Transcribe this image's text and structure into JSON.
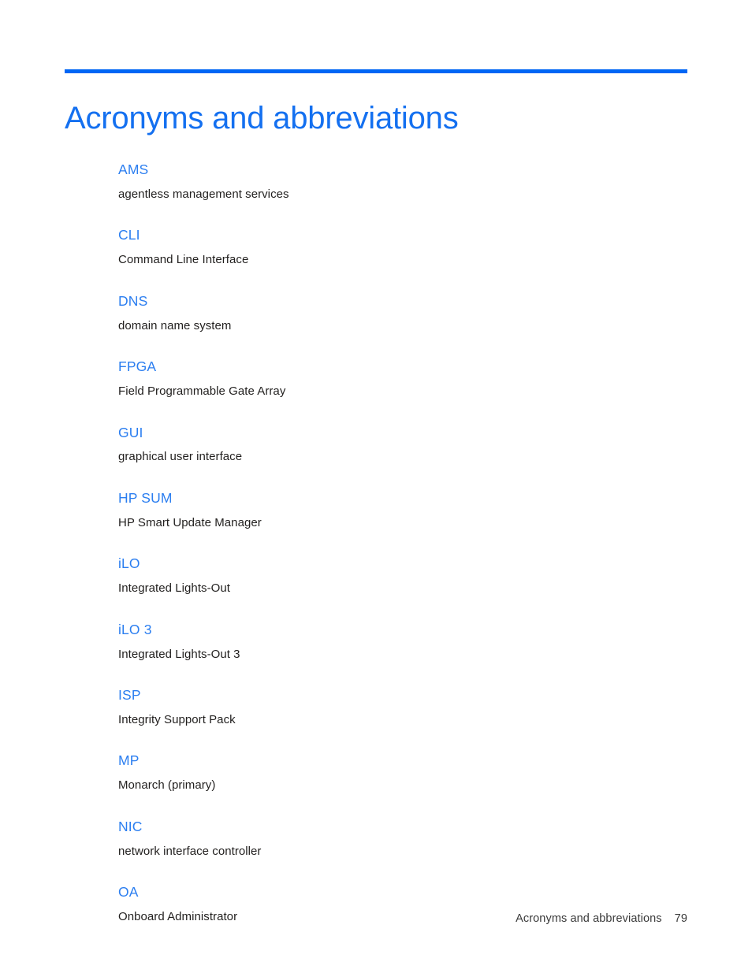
{
  "document": {
    "page_title": "Acronyms and abbreviations",
    "accent_color": "#0066f5",
    "title_color": "#1470f0",
    "term_color": "#2b7ef0",
    "definition_color": "#211f1e"
  },
  "glossary": {
    "entries": [
      {
        "term": "AMS",
        "definition": "agentless management services"
      },
      {
        "term": "CLI",
        "definition": "Command Line Interface"
      },
      {
        "term": "DNS",
        "definition": "domain name system"
      },
      {
        "term": "FPGA",
        "definition": "Field Programmable Gate Array"
      },
      {
        "term": "GUI",
        "definition": "graphical user interface"
      },
      {
        "term": "HP SUM",
        "definition": "HP Smart Update Manager"
      },
      {
        "term": "iLO",
        "definition": "Integrated Lights-Out"
      },
      {
        "term": "iLO 3",
        "definition": "Integrated Lights-Out 3"
      },
      {
        "term": "ISP",
        "definition": "Integrity Support Pack"
      },
      {
        "term": "MP",
        "definition": "Monarch (primary)"
      },
      {
        "term": "NIC",
        "definition": "network interface controller"
      },
      {
        "term": "OA",
        "definition": "Onboard Administrator"
      }
    ]
  },
  "footer": {
    "chapter": "Acronyms and abbreviations",
    "page_number": "79"
  }
}
